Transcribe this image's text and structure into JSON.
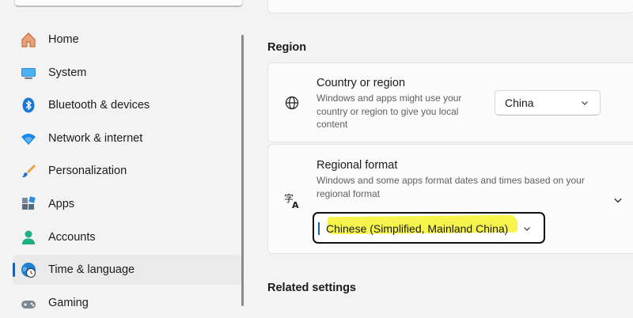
{
  "sidebar": {
    "items": [
      {
        "label": "Home",
        "icon": "home-icon"
      },
      {
        "label": "System",
        "icon": "monitor-icon"
      },
      {
        "label": "Bluetooth & devices",
        "icon": "bluetooth-icon"
      },
      {
        "label": "Network & internet",
        "icon": "wifi-icon"
      },
      {
        "label": "Personalization",
        "icon": "brush-icon"
      },
      {
        "label": "Apps",
        "icon": "apps-icon"
      },
      {
        "label": "Accounts",
        "icon": "person-icon"
      },
      {
        "label": "Time & language",
        "icon": "clock-globe-icon",
        "selected": true
      },
      {
        "label": "Gaming",
        "icon": "gamepad-icon"
      }
    ]
  },
  "main": {
    "region_section_title": "Region",
    "country": {
      "title": "Country or region",
      "description": "Windows and apps might use your country or region to give you local content",
      "value": "China"
    },
    "regional_format": {
      "title": "Regional format",
      "description": "Windows and some apps format dates and times based on your regional format",
      "value": "Chinese (Simplified, Mainland China)"
    },
    "related_section_title": "Related settings"
  },
  "colors": {
    "accent": "#1a5fb4",
    "highlight": "#f6f33a",
    "background": "#f3f3f3",
    "card": "#fbfbfb"
  }
}
